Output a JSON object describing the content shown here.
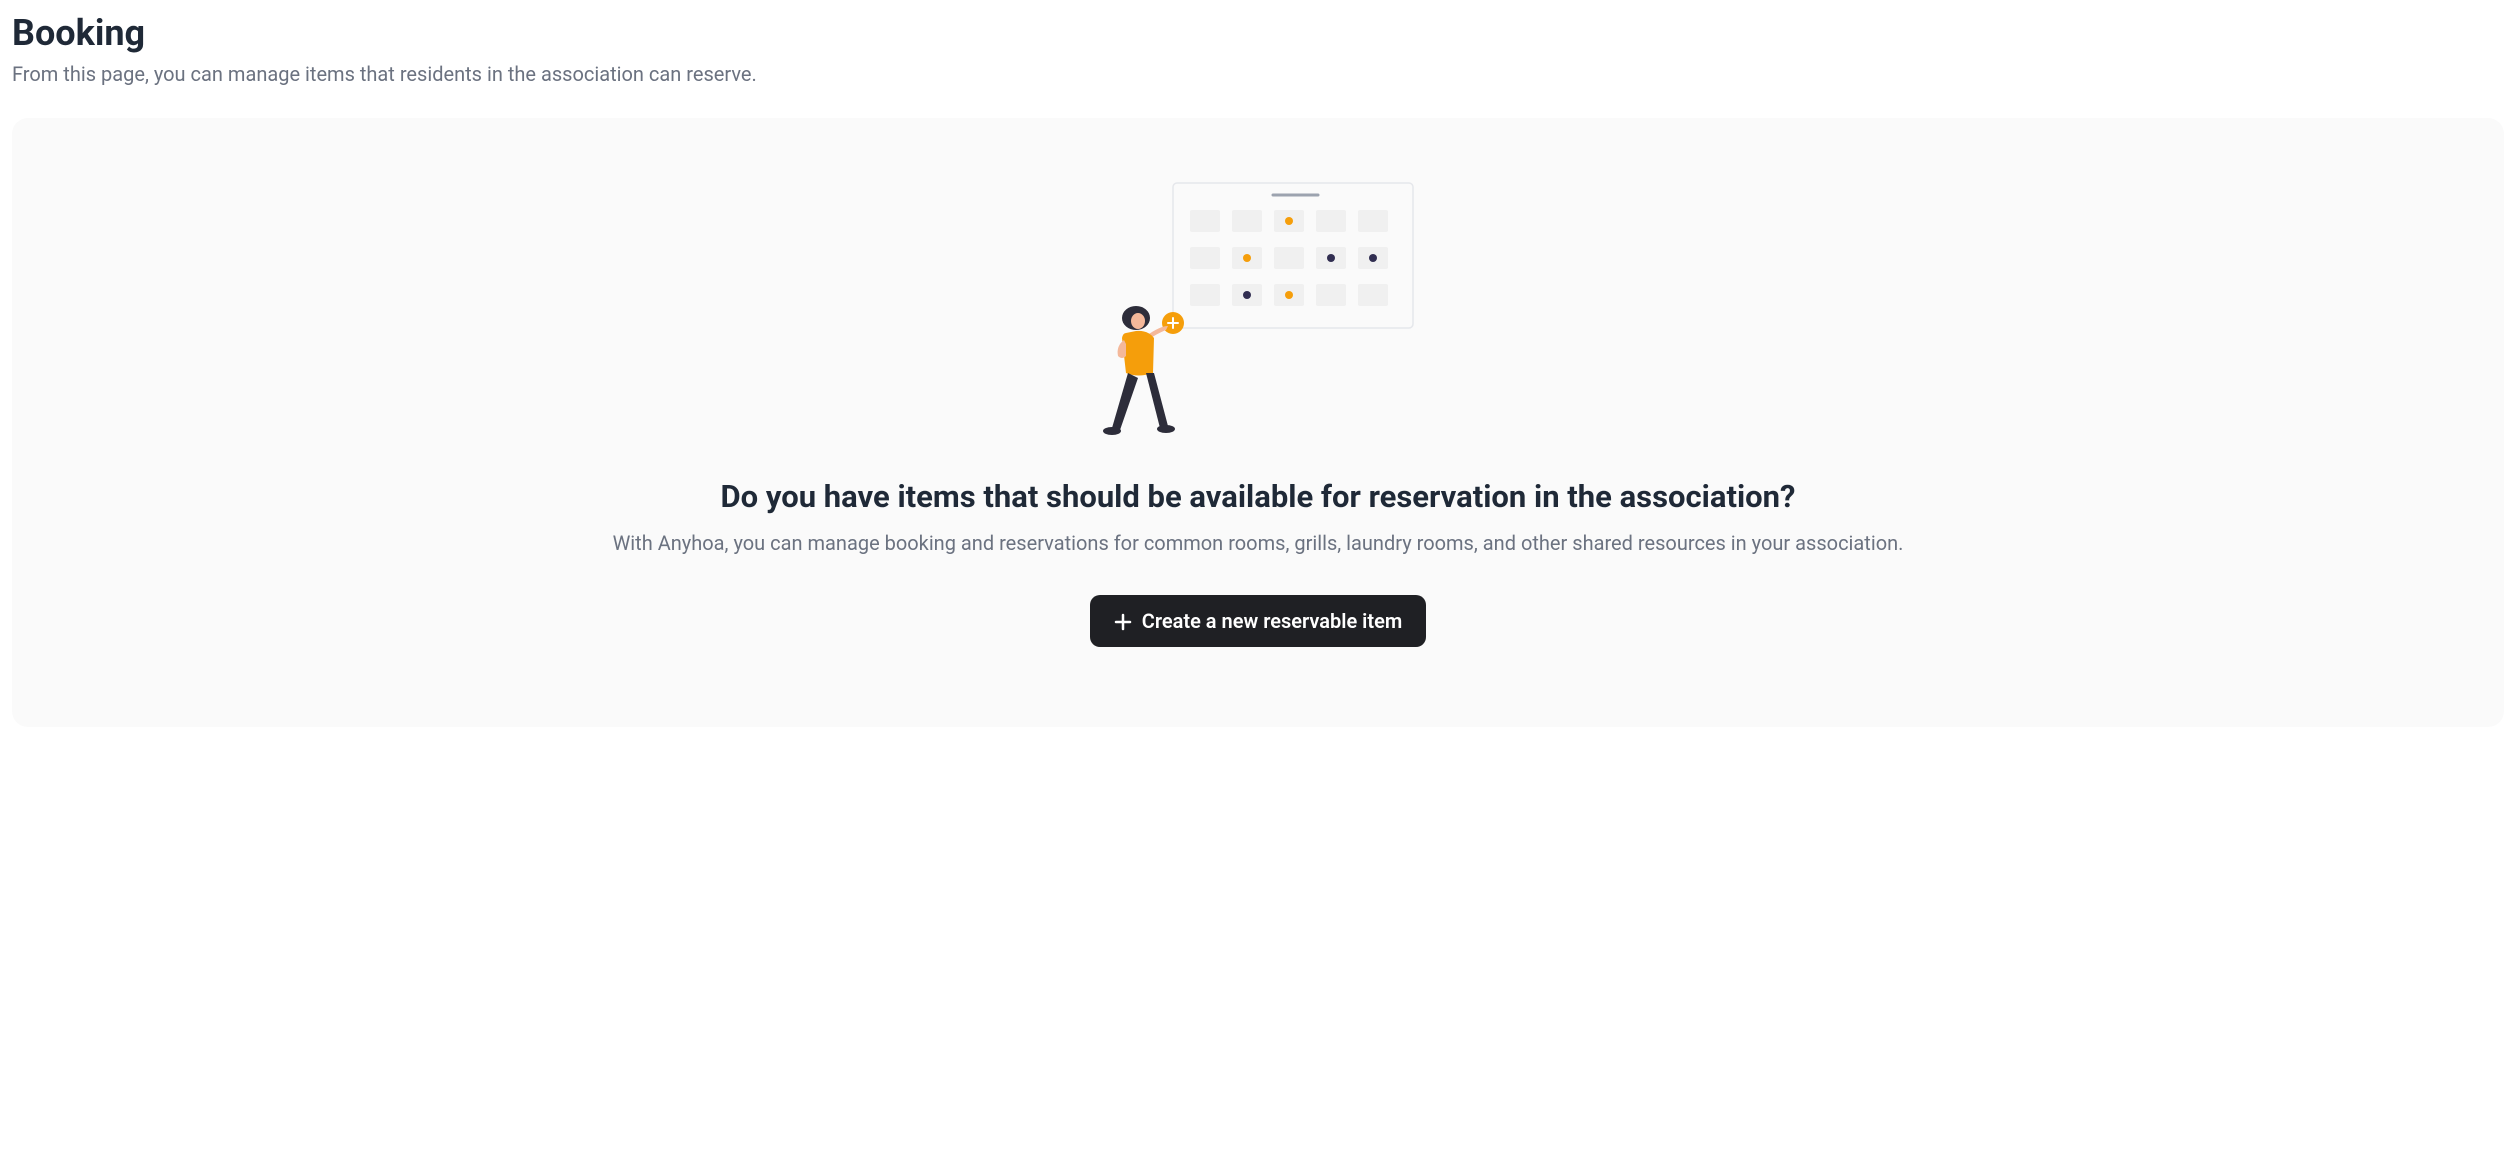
{
  "header": {
    "title": "Booking",
    "subtitle": "From this page, you can manage items that residents in the association can reserve."
  },
  "emptyState": {
    "heading": "Do you have items that should be available for reservation in the association?",
    "description": "With Anyhoa, you can manage booking and reservations for common rooms, grills, laundry rooms, and other shared resources in your association.",
    "buttonLabel": "Create a new reservable item"
  },
  "icons": {
    "plus": "plus-icon",
    "calendarIllustration": "calendar-person-illustration"
  },
  "colors": {
    "accent": "#f59e0b",
    "darkDot": "#312e51",
    "buttonBg": "#1f2024",
    "textPrimary": "#1f2937",
    "textSecondary": "#6b7280",
    "cardBg": "#fafafa"
  }
}
